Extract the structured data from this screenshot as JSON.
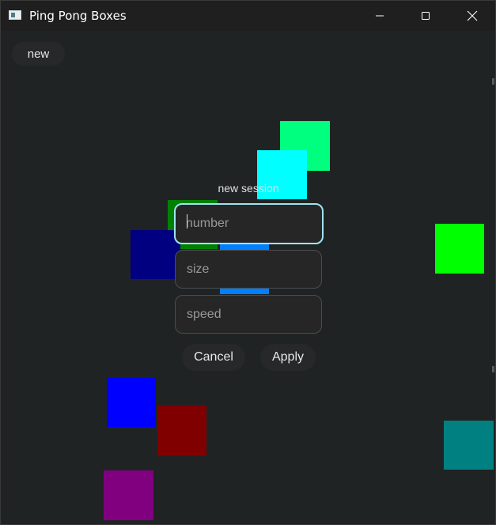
{
  "window": {
    "title": "Ping Pong Boxes",
    "icon": "app-window-icon",
    "controls": {
      "minimize": "minimize-icon",
      "maximize": "maximize-icon",
      "close": "close-icon"
    }
  },
  "toolbar": {
    "new_label": "new"
  },
  "boxes": [
    {
      "name": "spring-green-box",
      "color": "#00ff7f"
    },
    {
      "name": "cyan-box",
      "color": "#00ffff"
    },
    {
      "name": "green-box",
      "color": "#008000"
    },
    {
      "name": "navy-box",
      "color": "#000080"
    },
    {
      "name": "lime-box",
      "color": "#00ff00"
    },
    {
      "name": "azure-box",
      "color": "#0080ff"
    },
    {
      "name": "blue-box",
      "color": "#0000ff"
    },
    {
      "name": "maroon-box",
      "color": "#800000"
    },
    {
      "name": "teal-box",
      "color": "#008080"
    },
    {
      "name": "purple-box",
      "color": "#800080"
    }
  ],
  "dialog": {
    "title": "new session",
    "fields": [
      {
        "name": "number",
        "placeholder": "number",
        "value": ""
      },
      {
        "name": "size",
        "placeholder": "size",
        "value": ""
      },
      {
        "name": "speed",
        "placeholder": "speed",
        "value": ""
      }
    ],
    "cancel_label": "Cancel",
    "apply_label": "Apply"
  },
  "colors": {
    "background": "#202324",
    "titlebar": "#1f1f1f",
    "focus_border": "#9fe4ef"
  }
}
